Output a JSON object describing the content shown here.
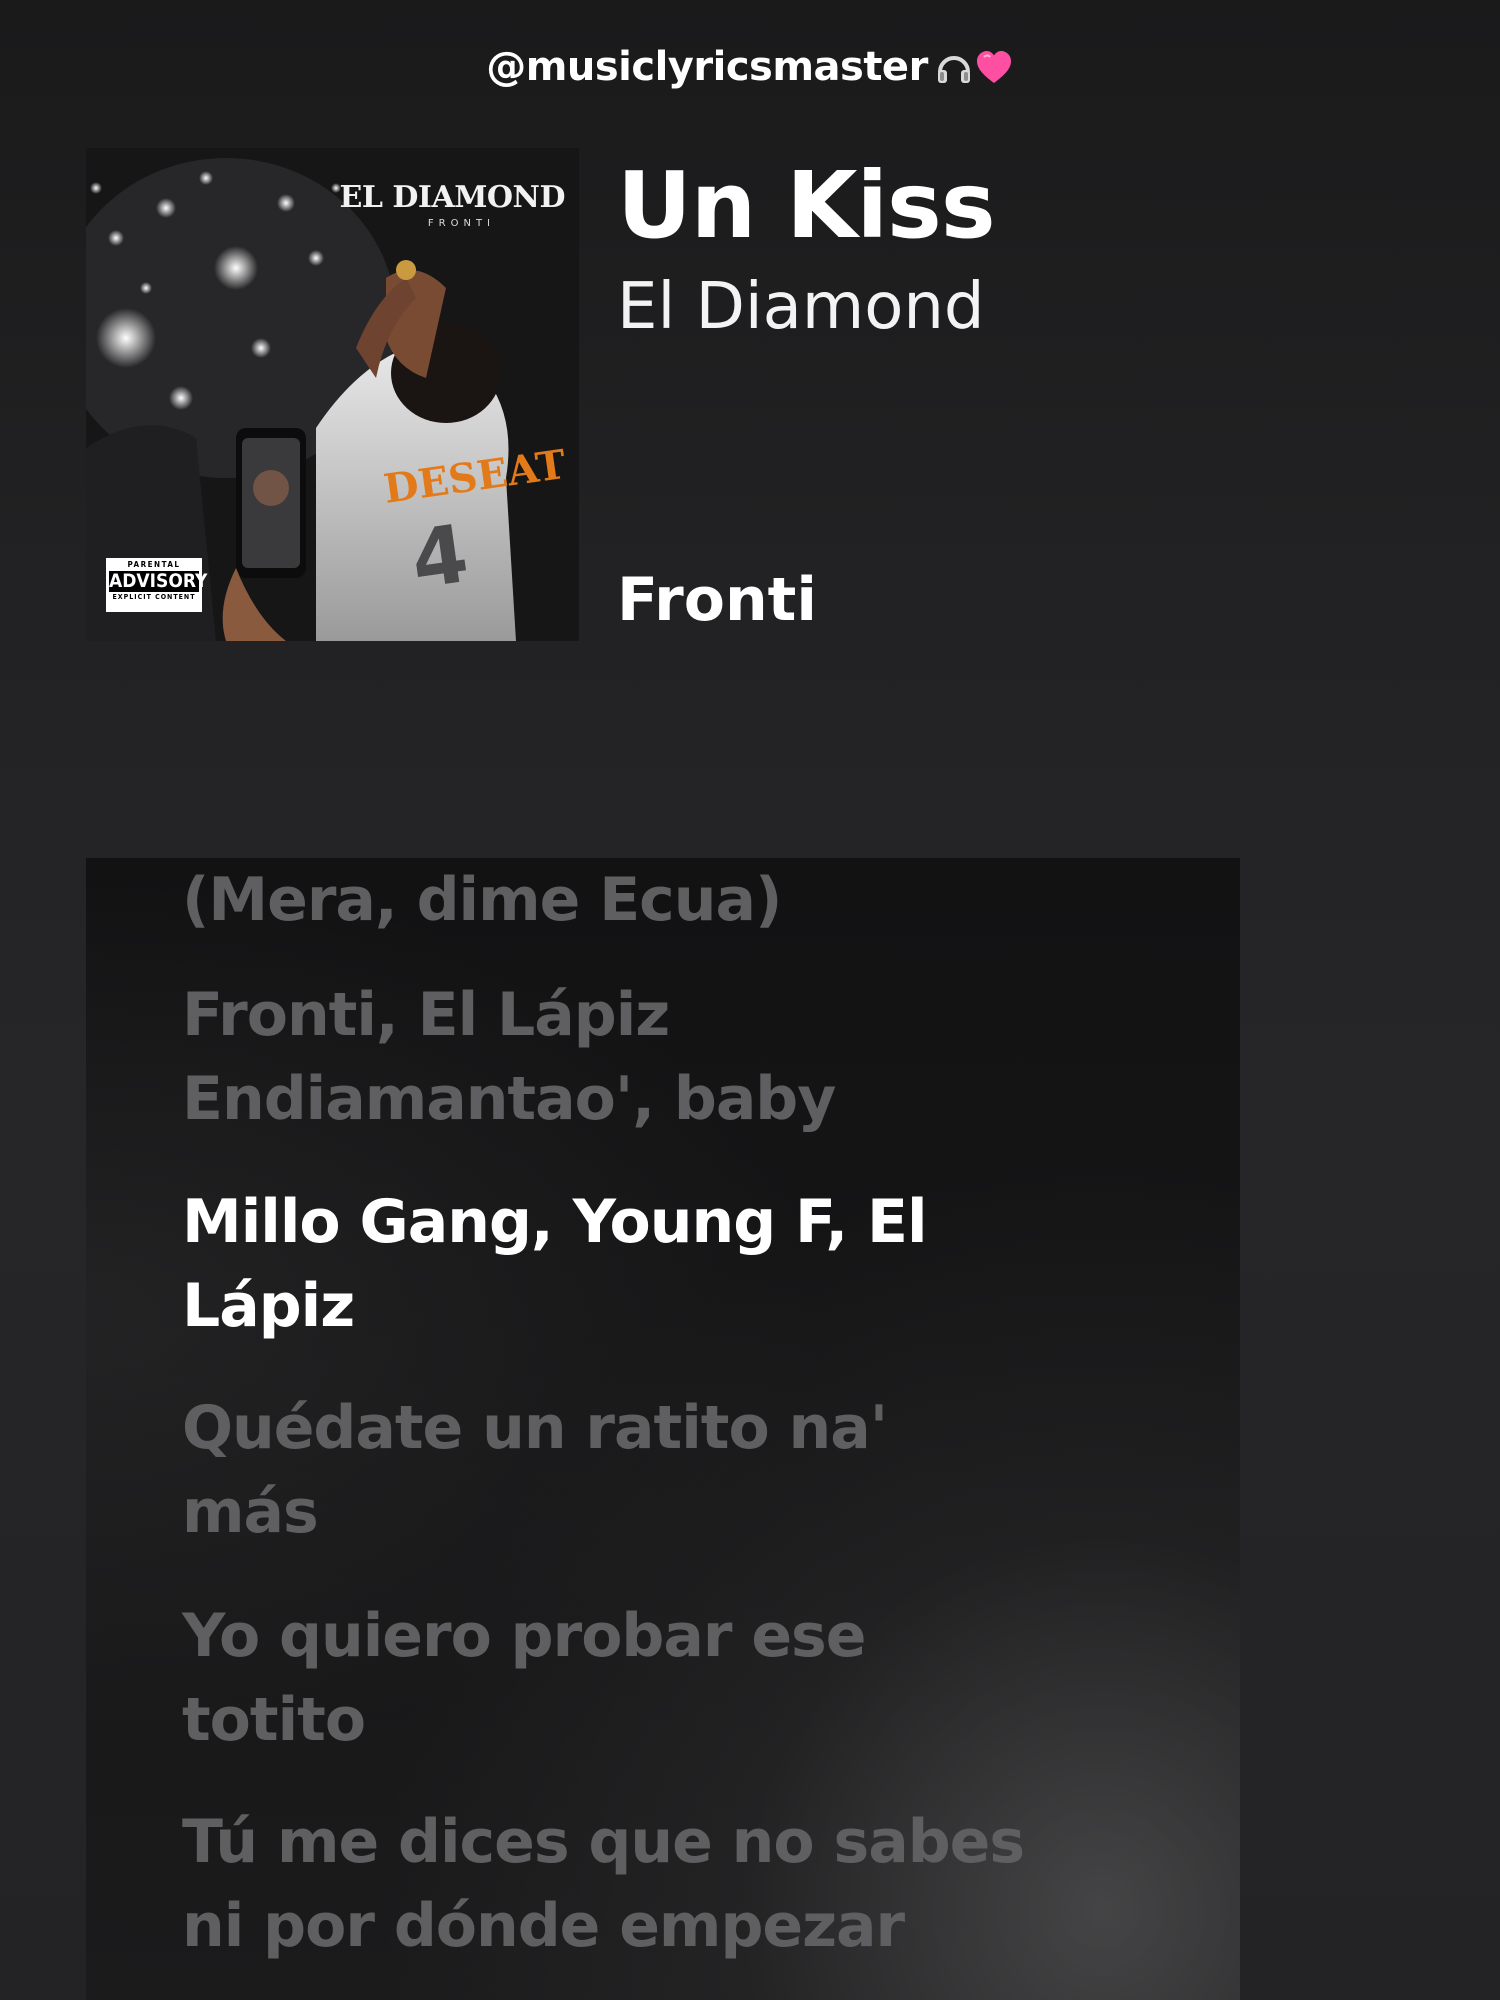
{
  "header": {
    "handle": "@musiclyricsmaster",
    "icons": [
      "headphones-icon",
      "heart-icon"
    ],
    "heart_color": "#ff4fa3"
  },
  "cover": {
    "title": "EL DIAMOND",
    "subtitle": "FRONTI",
    "advisory": {
      "line1": "PARENTAL",
      "line2": "ADVISORY",
      "line3": "EXPLICIT CONTENT"
    },
    "jersey_text": "DESEAT"
  },
  "track": {
    "title": "Un Kiss",
    "album": "El Diamond",
    "artist": "Fronti"
  },
  "lyrics": {
    "lines": [
      "(Mera, dime Ecua)",
      "Fronti, El Lápiz\nEndiamantao', baby",
      "Millo Gang, Young F, El\nLápiz",
      "Quédate un ratito na'\nmás",
      "Yo quiero probar ese\ntotito",
      "Tú me dices que no sabes\nni por dónde empezar"
    ],
    "active_index": 2,
    "active_color": "#ffffff",
    "inactive_color": "#5f5f61"
  }
}
